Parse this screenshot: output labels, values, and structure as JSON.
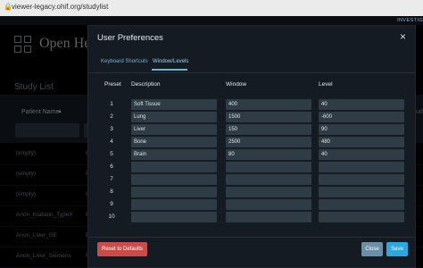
{
  "browser": {
    "url": "viewer-legacy.ohif.org/studylist"
  },
  "header": {
    "app_title": "Open Hea",
    "investigational": "INVESTIG"
  },
  "study_list": {
    "title": "Study List",
    "column_patient": "Patient Name",
    "column_right": "udi",
    "rows": [
      {
        "name": "(empty)",
        "p": "P"
      },
      {
        "name": "(empty)",
        "p": "P"
      },
      {
        "name": "(empty)",
        "p": "P"
      },
      {
        "name": "Anon_Klatskin_TypeX",
        "p": "P"
      },
      {
        "name": "Anon_Liver_GE",
        "p": "P"
      },
      {
        "name": "Anon_Liver_Siemens",
        "p": "P"
      }
    ]
  },
  "modal": {
    "title": "User Preferences",
    "tabs": [
      "Keyboard Shortcuts",
      "Window/Levels"
    ],
    "active_tab": "Window/Levels",
    "columns": {
      "preset": "Preset",
      "description": "Description",
      "window": "Window",
      "level": "Level"
    },
    "presets": [
      {
        "n": "1",
        "description": "Soft Tissue",
        "window": "400",
        "level": "40"
      },
      {
        "n": "2",
        "description": "Lung",
        "window": "1500",
        "level": "-600"
      },
      {
        "n": "3",
        "description": "Liver",
        "window": "150",
        "level": "90"
      },
      {
        "n": "4",
        "description": "Bone",
        "window": "2500",
        "level": "480"
      },
      {
        "n": "5",
        "description": "Brain",
        "window": "80",
        "level": "40"
      },
      {
        "n": "6",
        "description": "",
        "window": "",
        "level": ""
      },
      {
        "n": "7",
        "description": "",
        "window": "",
        "level": ""
      },
      {
        "n": "8",
        "description": "",
        "window": "",
        "level": ""
      },
      {
        "n": "9",
        "description": "",
        "window": "",
        "level": ""
      },
      {
        "n": "10",
        "description": "",
        "window": "",
        "level": ""
      }
    ],
    "buttons": {
      "reset": "Reset to Defaults",
      "close": "Close",
      "save": "Save"
    },
    "close_icon": "×"
  }
}
